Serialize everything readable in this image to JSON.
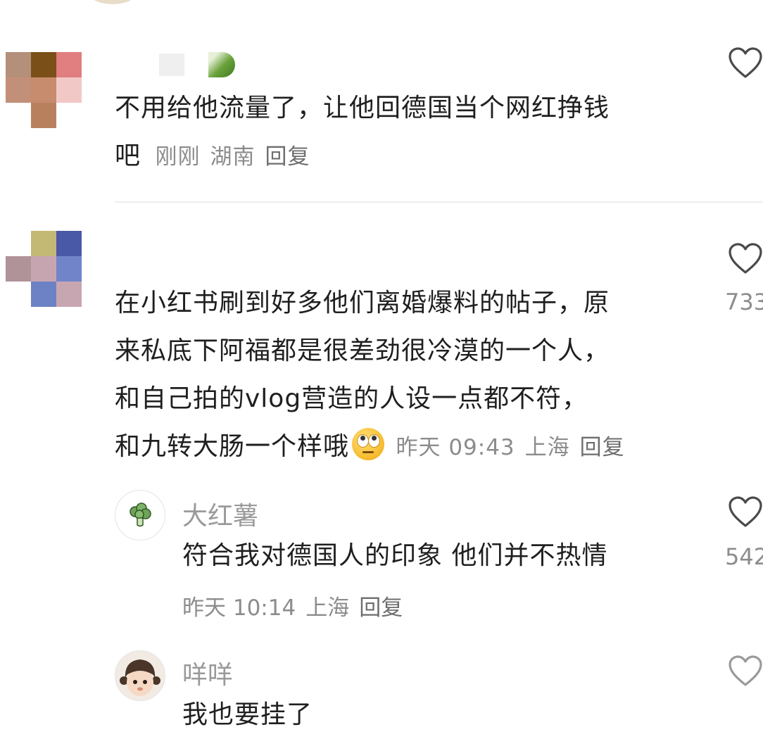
{
  "colors": {
    "text": "#1f1f1f",
    "meta": "#8c8c8c",
    "divider": "#eeeeee",
    "heart_stroke": "#4a4a4a"
  },
  "comments": [
    {
      "avatar": "pixelated-avatar",
      "text": "不用给他流量了，让他回德国当个网红挣钱吧",
      "text_lines": [
        "不用给他流量了，让他回德国当个网红挣钱",
        "吧"
      ],
      "time": "刚刚",
      "location": "湖南",
      "reply_label": "回复",
      "like_count": ""
    },
    {
      "avatar": "pixelated-avatar",
      "text_lines": [
        "在小红书刷到好多他们离婚爆料的帖子，原",
        "来私底下阿福都是很差劲很冷漠的一个人，",
        "和自己拍的vlog营造的人设一点都不符，",
        "和九转大肠一个样哦"
      ],
      "emoji": "face-with-rolling-eyes",
      "time": "昨天 09:43",
      "location": "上海",
      "reply_label": "回复",
      "like_count": "733",
      "replies": [
        {
          "avatar": "broccoli-avatar",
          "username": "大红薯",
          "text": "符合我对德国人的印象 他们并不热情",
          "time": "昨天 10:14",
          "location": "上海",
          "reply_label": "回复",
          "like_count": "542"
        },
        {
          "avatar": "child-photo-avatar",
          "username": "咩咩",
          "text": "我也要挂了",
          "like_count": ""
        }
      ]
    }
  ]
}
